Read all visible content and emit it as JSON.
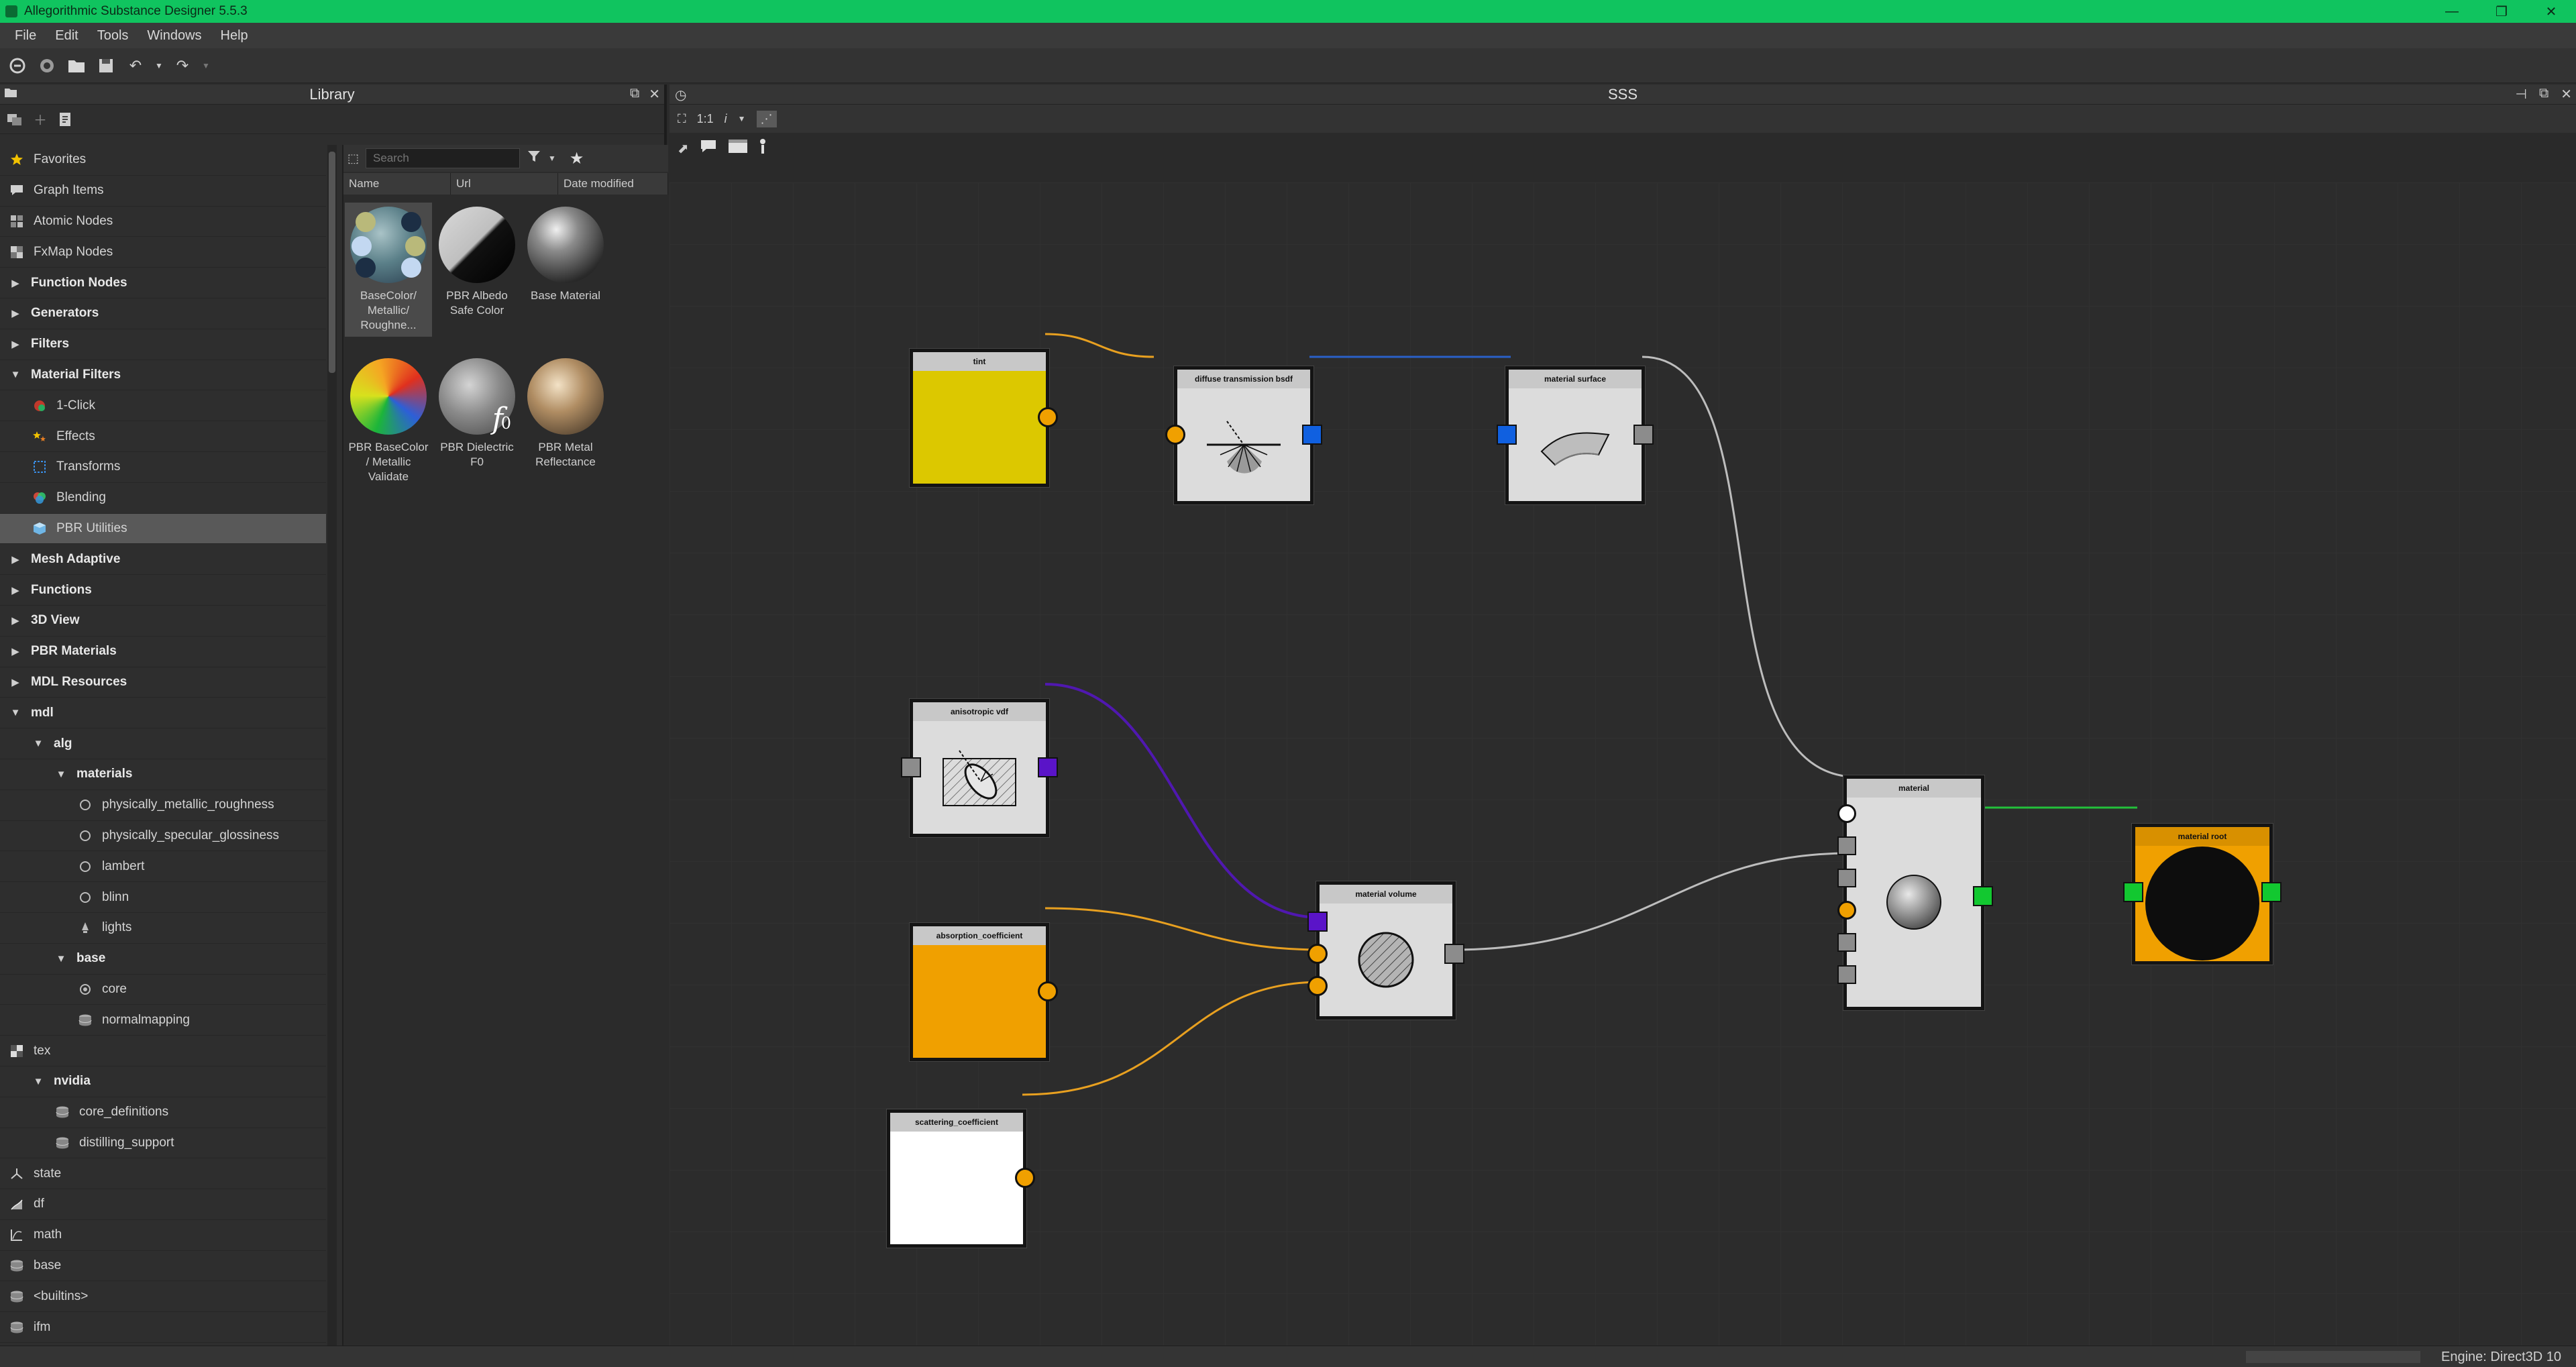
{
  "window": {
    "title": "Allegorithmic Substance Designer 5.5.3",
    "controls": [
      "—",
      "❐",
      "✕"
    ]
  },
  "menu": [
    "File",
    "Edit",
    "Tools",
    "Windows",
    "Help"
  ],
  "library": {
    "title": "Library",
    "search_placeholder": "Search",
    "columns": [
      "Name",
      "Url",
      "Date modified"
    ],
    "tree": [
      {
        "label": "Favorites",
        "indent": 0,
        "arrow": "",
        "icon": "star",
        "bold": false
      },
      {
        "label": "Graph Items",
        "indent": 0,
        "arrow": "",
        "icon": "comment",
        "bold": false
      },
      {
        "label": "Atomic Nodes",
        "indent": 0,
        "arrow": "",
        "icon": "atomic",
        "bold": false
      },
      {
        "label": "FxMap Nodes",
        "indent": 0,
        "arrow": "",
        "icon": "fxmap",
        "bold": false
      },
      {
        "label": "Function Nodes",
        "indent": 0,
        "arrow": "▶",
        "icon": "",
        "bold": true
      },
      {
        "label": "Generators",
        "indent": 0,
        "arrow": "▶",
        "icon": "",
        "bold": true
      },
      {
        "label": "Filters",
        "indent": 0,
        "arrow": "▶",
        "icon": "",
        "bold": true
      },
      {
        "label": "Material Filters",
        "indent": 0,
        "arrow": "▼",
        "icon": "",
        "bold": true
      },
      {
        "label": "1-Click",
        "indent": 1,
        "arrow": "",
        "icon": "oneclick",
        "bold": false
      },
      {
        "label": "Effects",
        "indent": 1,
        "arrow": "",
        "icon": "effects",
        "bold": false
      },
      {
        "label": "Transforms",
        "indent": 1,
        "arrow": "",
        "icon": "transforms",
        "bold": false
      },
      {
        "label": "Blending",
        "indent": 1,
        "arrow": "",
        "icon": "blending",
        "bold": false
      },
      {
        "label": "PBR Utilities",
        "indent": 1,
        "arrow": "",
        "icon": "pbr",
        "bold": false,
        "selected": true
      },
      {
        "label": "Mesh Adaptive",
        "indent": 0,
        "arrow": "▶",
        "icon": "",
        "bold": true
      },
      {
        "label": "Functions",
        "indent": 0,
        "arrow": "▶",
        "icon": "",
        "bold": true
      },
      {
        "label": "3D View",
        "indent": 0,
        "arrow": "▶",
        "icon": "",
        "bold": true
      },
      {
        "label": "PBR Materials",
        "indent": 0,
        "arrow": "▶",
        "icon": "",
        "bold": true
      },
      {
        "label": "MDL Resources",
        "indent": 0,
        "arrow": "▶",
        "icon": "",
        "bold": true
      },
      {
        "label": "mdl",
        "indent": 0,
        "arrow": "▼",
        "icon": "",
        "bold": true
      },
      {
        "label": "alg",
        "indent": 1,
        "arrow": "▼",
        "icon": "",
        "bold": true
      },
      {
        "label": "materials",
        "indent": 2,
        "arrow": "▼",
        "icon": "",
        "bold": true
      },
      {
        "label": "physically_metallic_roughness",
        "indent": 3,
        "arrow": "",
        "icon": "circle",
        "bold": false
      },
      {
        "label": "physically_specular_glossiness",
        "indent": 3,
        "arrow": "",
        "icon": "circle",
        "bold": false
      },
      {
        "label": "lambert",
        "indent": 3,
        "arrow": "",
        "icon": "circle",
        "bold": false
      },
      {
        "label": "blinn",
        "indent": 3,
        "arrow": "",
        "icon": "circle",
        "bold": false
      },
      {
        "label": "lights",
        "indent": 3,
        "arrow": "",
        "icon": "light",
        "bold": false
      },
      {
        "label": "base",
        "indent": 2,
        "arrow": "▼",
        "icon": "",
        "bold": true
      },
      {
        "label": "core",
        "indent": 3,
        "arrow": "",
        "icon": "circle-dot",
        "bold": false
      },
      {
        "label": "normalmapping",
        "indent": 3,
        "arrow": "",
        "icon": "stack",
        "bold": false
      },
      {
        "label": "tex",
        "indent": 0,
        "arrow": "",
        "icon": "checker",
        "bold": false
      },
      {
        "label": "nvidia",
        "indent": 1,
        "arrow": "▼",
        "icon": "",
        "bold": true
      },
      {
        "label": "core_definitions",
        "indent": 2,
        "arrow": "",
        "icon": "stack",
        "bold": false
      },
      {
        "label": "distilling_support",
        "indent": 2,
        "arrow": "",
        "icon": "stack",
        "bold": false
      },
      {
        "label": "state",
        "indent": 0,
        "arrow": "",
        "icon": "axes",
        "bold": false
      },
      {
        "label": "df",
        "indent": 0,
        "arrow": "",
        "icon": "df",
        "bold": false
      },
      {
        "label": "math",
        "indent": 0,
        "arrow": "",
        "icon": "math",
        "bold": false
      },
      {
        "label": "base",
        "indent": 0,
        "arrow": "",
        "icon": "stack",
        "bold": false
      },
      {
        "label": "<builtins>",
        "indent": 0,
        "arrow": "",
        "icon": "stack",
        "bold": false
      },
      {
        "label": "ifm",
        "indent": 0,
        "arrow": "",
        "icon": "stack",
        "bold": false
      }
    ],
    "thumbnails": [
      {
        "lines": [
          "BaseColor/",
          "Metallic/",
          "Roughne..."
        ],
        "selected": true,
        "style": "basecolor"
      },
      {
        "lines": [
          "PBR Albedo",
          "Safe Color"
        ],
        "selected": false,
        "style": "albedo"
      },
      {
        "lines": [
          "Base Material"
        ],
        "selected": false,
        "style": "basematerial"
      },
      {
        "lines": [
          "PBR BaseColor",
          "/ Metallic",
          "Validate"
        ],
        "selected": false,
        "style": "validate"
      },
      {
        "lines": [
          "PBR Dielectric",
          "F0"
        ],
        "selected": false,
        "style": "dielectric"
      },
      {
        "lines": [
          "PBR Metal",
          "Reflectance"
        ],
        "selected": false,
        "style": "metal"
      }
    ]
  },
  "graph": {
    "title": "SSS",
    "zoom_label": "1:1",
    "nodes": [
      {
        "id": "tint",
        "title": "tint",
        "color": "#dcc800"
      },
      {
        "id": "dtb",
        "title": "diffuse transmission bsdf"
      },
      {
        "id": "surface",
        "title": "material surface"
      },
      {
        "id": "avdf",
        "title": "anisotropic vdf"
      },
      {
        "id": "absorption",
        "title": "absorption_coefficient",
        "color": "#f0a000"
      },
      {
        "id": "volume",
        "title": "material volume"
      },
      {
        "id": "scattering",
        "title": "scattering_coefficient",
        "color": "#ffffff"
      },
      {
        "id": "material",
        "title": "material"
      },
      {
        "id": "root",
        "title": "material root"
      }
    ],
    "colors": {
      "orange_port": "#f0a000",
      "blue_port": "#1060e0",
      "purple_port": "#5a14c8",
      "green_port": "#12c830",
      "gray_port": "#8c8c8c",
      "wire_orange": "#e8a020",
      "wire_blue": "#2a60c8",
      "wire_purple": "#5018b0",
      "wire_gray": "#bdbdbd",
      "wire_green": "#22c03a"
    }
  },
  "status": {
    "engine": "Engine: Direct3D 10"
  }
}
